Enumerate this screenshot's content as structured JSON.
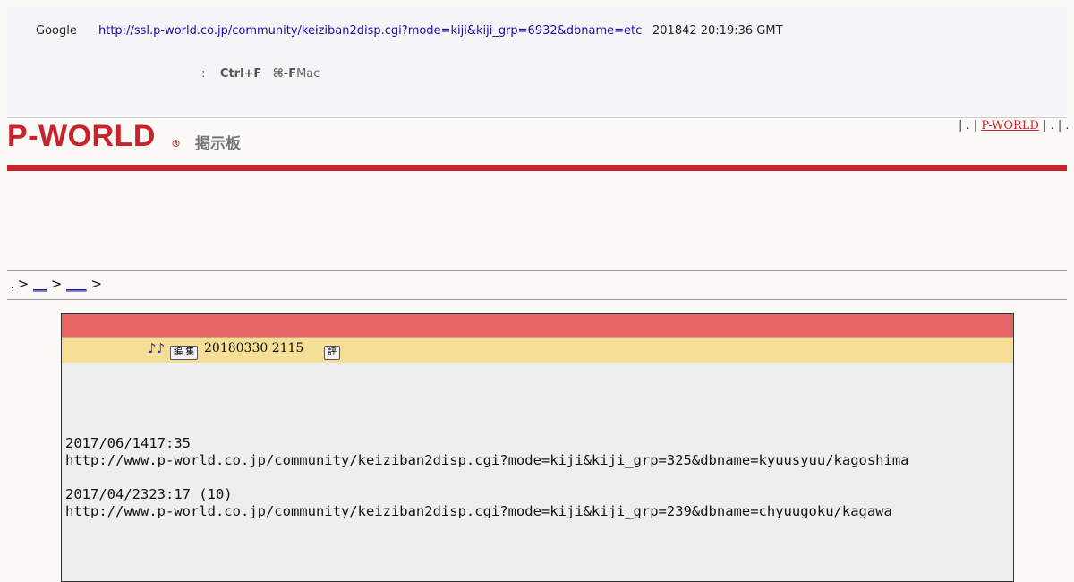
{
  "cache_header": {
    "source": "Google",
    "url": "http://ssl.p-world.co.jp/community/keiziban2disp.cgi?mode=kiji&kiji_grp=6932&dbname=etc",
    "snapshot_date": "201842 20:19:36 GMT",
    "tip_prefix": ":",
    "shortcut_win": "Ctrl+F",
    "shortcut_mac_key": "⌘-F",
    "shortcut_mac_label": "Mac"
  },
  "site": {
    "logo": "P-WORLD",
    "logo_mark": "®",
    "board_title": "掲示板",
    "top_links_prefix": "| . |",
    "top_link": "P-WORLD",
    "top_links_suffix": " | . | . |"
  },
  "breadcrumb": {
    "lead": ".",
    "sep": ">",
    "link1": "__",
    "link2": "___"
  },
  "post": {
    "notes_icon": "♪♪",
    "edit_button": "編 集",
    "date": "20180330 2115",
    "rate_button": "評",
    "refs": [
      {
        "date": "2017/06/1417:35",
        "url": "http://www.p-world.co.jp/community/keiziban2disp.cgi?mode=kiji&kiji_grp=325&dbname=kyuusyuu/kagoshima"
      },
      {
        "date": "2017/04/2323:17 (10)",
        "url": "http://www.p-world.co.jp/community/keiziban2disp.cgi?mode=kiji&kiji_grp=239&dbname=chyuugoku/kagawa"
      }
    ]
  },
  "colors": {
    "brand_red": "#c8232a",
    "post_title_bar": "#e66666",
    "post_meta_bar": "#f5df97",
    "link_blue": "#1a0dab"
  }
}
